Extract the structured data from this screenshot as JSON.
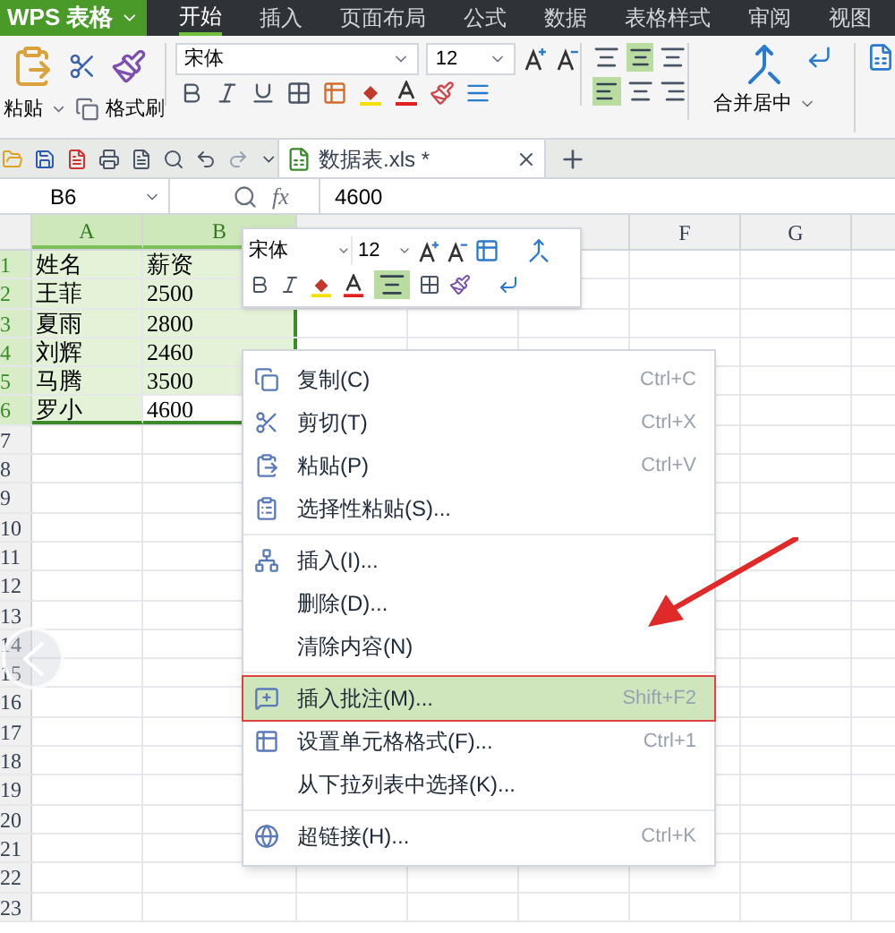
{
  "app": {
    "title": "WPS 表格"
  },
  "tabs": [
    {
      "label": "开始",
      "selected": true
    },
    {
      "label": "插入",
      "selected": false
    },
    {
      "label": "页面布局",
      "selected": false
    },
    {
      "label": "公式",
      "selected": false
    },
    {
      "label": "数据",
      "selected": false
    },
    {
      "label": "表格样式",
      "selected": false
    },
    {
      "label": "审阅",
      "selected": false
    },
    {
      "label": "视图",
      "selected": false
    }
  ],
  "ribbon": {
    "paste": "粘贴",
    "format_painter": "格式刷",
    "font": "宋体",
    "size": "12",
    "merge": "合并居中"
  },
  "document_tab": {
    "title": "数据表.xls *"
  },
  "formula_bar": {
    "cell": "B6",
    "fx": "fx",
    "value": "4600"
  },
  "sheet": {
    "columns": [
      {
        "label": "A",
        "selected": true
      },
      {
        "label": "B",
        "selected": true
      },
      {
        "label": "F",
        "selected": false
      },
      {
        "label": "G",
        "selected": false
      }
    ],
    "rows": [
      {
        "number": "1",
        "selected": true,
        "cells": [
          {
            "text": "姓名",
            "selected": true,
            "active": false
          },
          {
            "text": "薪资",
            "selected": true,
            "active": false
          }
        ]
      },
      {
        "number": "2",
        "selected": true,
        "cells": [
          {
            "text": "王菲",
            "selected": true,
            "active": false
          },
          {
            "text": "2500",
            "selected": true,
            "active": false
          }
        ]
      },
      {
        "number": "3",
        "selected": true,
        "cells": [
          {
            "text": "夏雨",
            "selected": true,
            "active": false
          },
          {
            "text": "2800",
            "selected": true,
            "active": false
          }
        ]
      },
      {
        "number": "4",
        "selected": true,
        "cells": [
          {
            "text": "刘辉",
            "selected": true,
            "active": false
          },
          {
            "text": "2460",
            "selected": true,
            "active": false
          }
        ]
      },
      {
        "number": "5",
        "selected": true,
        "cells": [
          {
            "text": "马腾",
            "selected": true,
            "active": false
          },
          {
            "text": "3500",
            "selected": true,
            "active": false
          }
        ]
      },
      {
        "number": "6",
        "selected": true,
        "cells": [
          {
            "text": "罗小",
            "selected": true,
            "active": false
          },
          {
            "text": "4600",
            "selected": true,
            "active": true
          }
        ]
      },
      {
        "number": "7",
        "selected": false
      },
      {
        "number": "8",
        "selected": false
      },
      {
        "number": "9",
        "selected": false
      },
      {
        "number": "10",
        "selected": false
      },
      {
        "number": "11",
        "selected": false
      },
      {
        "number": "12",
        "selected": false
      },
      {
        "number": "13",
        "selected": false
      },
      {
        "number": "14",
        "selected": false
      },
      {
        "number": "15",
        "selected": false
      },
      {
        "number": "16",
        "selected": false
      },
      {
        "number": "17",
        "selected": false
      },
      {
        "number": "18",
        "selected": false
      },
      {
        "number": "19",
        "selected": false
      },
      {
        "number": "20",
        "selected": false
      },
      {
        "number": "21",
        "selected": false
      },
      {
        "number": "22",
        "selected": false
      },
      {
        "number": "23",
        "selected": false
      }
    ]
  },
  "mini_toolbar": {
    "font": "宋体",
    "size": "12"
  },
  "context_menu": {
    "items": [
      {
        "kind": "item",
        "label": "复制(C)",
        "shortcut": "Ctrl+C",
        "highlighted": false
      },
      {
        "kind": "item",
        "label": "剪切(T)",
        "shortcut": "Ctrl+X",
        "highlighted": false
      },
      {
        "kind": "item",
        "label": "粘贴(P)",
        "shortcut": "Ctrl+V",
        "highlighted": false
      },
      {
        "kind": "item",
        "label": "选择性粘贴(S)...",
        "highlighted": false
      },
      {
        "kind": "separator"
      },
      {
        "kind": "item",
        "label": "插入(I)...",
        "highlighted": false
      },
      {
        "kind": "item",
        "label": "删除(D)...",
        "highlighted": false
      },
      {
        "kind": "item",
        "label": "清除内容(N)",
        "highlighted": false
      },
      {
        "kind": "separator"
      },
      {
        "kind": "item",
        "label": "插入批注(M)...",
        "shortcut": "Shift+F2",
        "highlighted": true
      },
      {
        "kind": "item",
        "label": "设置单元格格式(F)...",
        "shortcut": "Ctrl+1",
        "highlighted": false
      },
      {
        "kind": "item",
        "label": "从下拉列表中选择(K)...",
        "highlighted": false
      },
      {
        "kind": "separator"
      },
      {
        "kind": "item",
        "label": "超链接(H)...",
        "shortcut": "Ctrl+K",
        "highlighted": false
      }
    ]
  },
  "annotations": {
    "callout_arrow": true,
    "highlight_box": true
  }
}
